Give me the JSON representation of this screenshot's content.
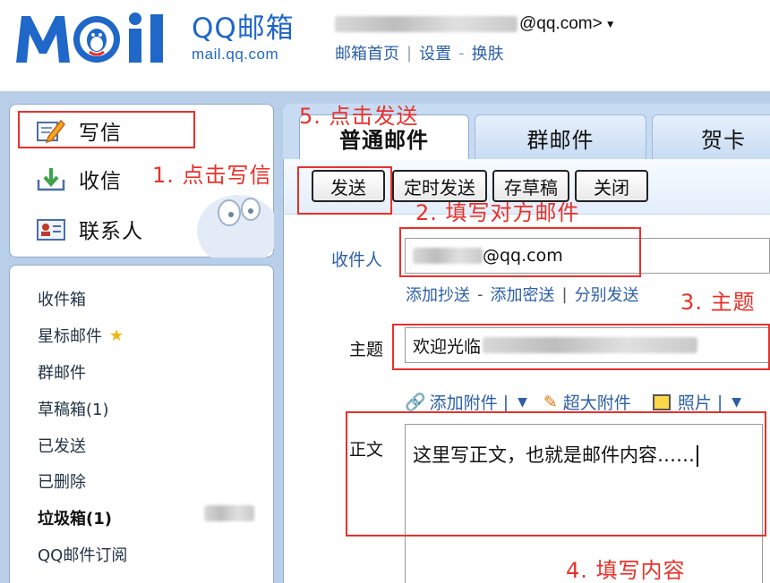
{
  "header": {
    "logo_text": "MQil",
    "brand_cn": "QQ邮箱",
    "brand_en": "mail.qq.com",
    "account_suffix": "@qq.com>",
    "links": [
      "邮箱首页",
      "设置",
      "换肤"
    ]
  },
  "sidebar": {
    "compose": "写信",
    "receive": "收信",
    "contacts": "联系人",
    "folders": [
      {
        "label": "收件箱"
      },
      {
        "label": "星标邮件"
      },
      {
        "label": "群邮件"
      },
      {
        "label": "草稿箱(1)"
      },
      {
        "label": "已发送"
      },
      {
        "label": "已删除"
      },
      {
        "label": "垃圾箱(1)"
      },
      {
        "label": "QQ邮件订阅"
      }
    ]
  },
  "tabs": [
    "普通邮件",
    "群邮件",
    "贺卡"
  ],
  "toolbar": {
    "send": "发送",
    "timed_send": "定时发送",
    "save_draft": "存草稿",
    "close": "关闭"
  },
  "form": {
    "recipient_label": "收件人",
    "recipient_value": "@qq.com",
    "add_cc": "添加抄送",
    "add_bcc": "添加密送",
    "separate_send": "分别发送",
    "subject_label": "主题",
    "subject_value": "欢迎光临",
    "add_attachment": "添加附件",
    "large_attachment": "超大附件",
    "photo": "照片",
    "body_label": "正文",
    "body_value": "这里写正文，也就是邮件内容……"
  },
  "annotations": {
    "n1": "1. 点击写信",
    "n2": "2. 填写对方邮件",
    "n3": "3. 主题",
    "n4": "4. 填写内容",
    "n5": "5. 点击发送"
  },
  "colors": {
    "brand_blue": "#1f67c8",
    "link_blue": "#2d5fa8",
    "annotation_red": "#e8312a"
  }
}
